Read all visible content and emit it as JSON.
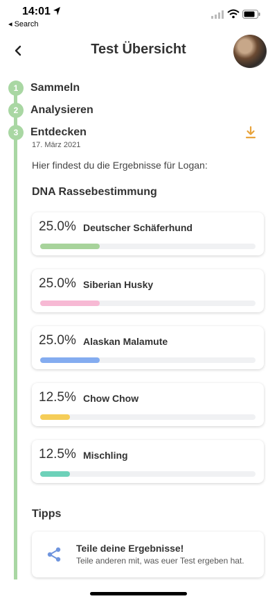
{
  "status": {
    "time": "14:01",
    "back_app": "◂ Search"
  },
  "header": {
    "title": "Test Übersicht"
  },
  "steps": [
    {
      "number": "1",
      "label": "Sammeln"
    },
    {
      "number": "2",
      "label": "Analysieren"
    },
    {
      "number": "3",
      "label": "Entdecken"
    }
  ],
  "discover": {
    "date": "17. März 2021",
    "intro": "Hier findest du die Ergebnisse für Logan:",
    "section_title": "DNA Rassebestimmung"
  },
  "results": [
    {
      "percent": "25.0%",
      "breed": "Deutscher Schäferhund",
      "fraction": 0.25,
      "color": "#a7d39b"
    },
    {
      "percent": "25.0%",
      "breed": "Siberian Husky",
      "fraction": 0.25,
      "color": "#f7b9d4"
    },
    {
      "percent": "25.0%",
      "breed": "Alaskan Malamute",
      "fraction": 0.25,
      "color": "#84acf0"
    },
    {
      "percent": "12.5%",
      "breed": "Chow Chow",
      "fraction": 0.125,
      "color": "#f5cd58"
    },
    {
      "percent": "12.5%",
      "breed": "Mischling",
      "fraction": 0.125,
      "color": "#6dd1b9"
    }
  ],
  "tips": {
    "title": "Tipps",
    "card_title": "Teile deine Ergebnisse!",
    "card_sub": "Teile anderen mit, was euer Test ergeben hat."
  },
  "colors": {
    "accent": "#a9d7a3",
    "download": "#e8a33c",
    "share": "#6f95de"
  }
}
